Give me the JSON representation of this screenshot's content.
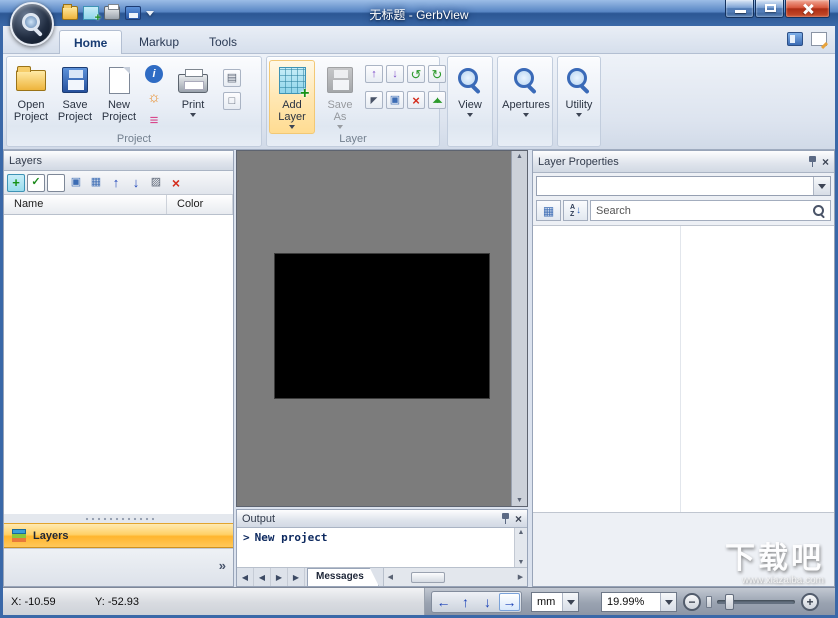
{
  "titlebar": {
    "title": "无标题 - GerbView"
  },
  "tabs": {
    "home": "Home",
    "markup": "Markup",
    "tools": "Tools"
  },
  "ribbon": {
    "project": {
      "label": "Project",
      "open1": "Open",
      "open2": "Project",
      "save1": "Save",
      "save2": "Project",
      "new1": "New",
      "new2": "Project",
      "print": "Print"
    },
    "layer": {
      "label": "Layer",
      "add1": "Add",
      "add2": "Layer",
      "saveas1": "Save",
      "saveas2": "As"
    },
    "view": "View",
    "apertures": "Apertures",
    "utility": "Utility"
  },
  "layers_panel": {
    "title": "Layers",
    "col_name": "Name",
    "col_color": "Color",
    "bottom_tab": "Layers"
  },
  "properties_panel": {
    "title": "Layer Properties",
    "search_placeholder": "Search"
  },
  "output_panel": {
    "title": "Output",
    "bullet": ">",
    "message": "New project",
    "tab": "Messages"
  },
  "statusbar": {
    "x": "X: -10.59",
    "y": "Y: -52.93",
    "units": "mm",
    "zoom": "19.99%"
  },
  "watermark": {
    "main": "下载吧",
    "sub": "www.xiazaiba.com"
  },
  "icons": {
    "dropdown": "▼",
    "up": "↑",
    "down": "↓",
    "left": "←",
    "right": "→",
    "check": "✓",
    "plus": "+",
    "cross": "×",
    "minus": "−",
    "chevrons": "»",
    "prev": "◀",
    "next": "▶",
    "tri_up": "▲",
    "tri_down": "▼",
    "info": "i",
    "gear": "☼",
    "stack": "≡",
    "copy": "▣",
    "grid": "▦",
    "hatch": "▨",
    "page": "□",
    "printer_small": "▤",
    "cursor": "◤",
    "mirror": "◢◣",
    "rot_left": "↺",
    "rot_right": "↻"
  },
  "colors": {
    "accent_orange": "#ffb52e",
    "frame_blue": "#3a68a8",
    "arrow_blue": "#1c43b8",
    "canvas_gray": "#7c7c7c"
  }
}
